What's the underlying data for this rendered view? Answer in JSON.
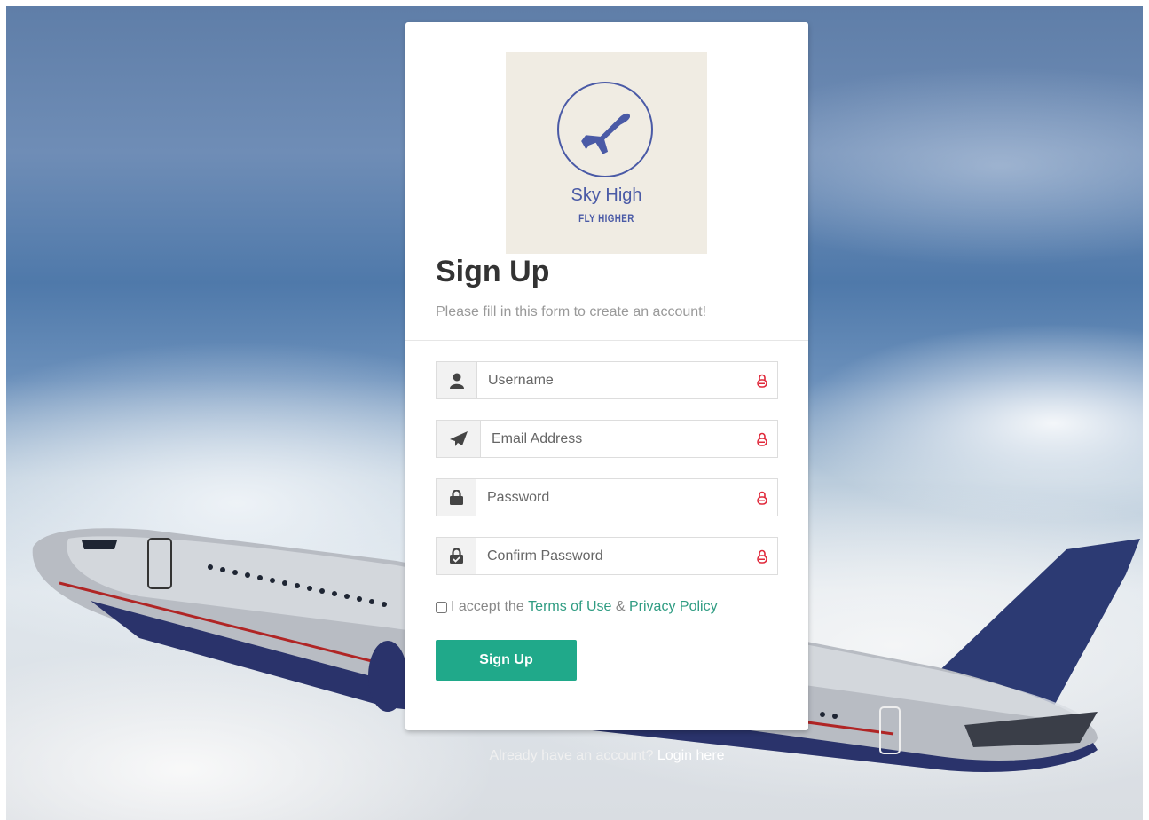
{
  "brand": {
    "name": "Sky High",
    "tagline": "FLY HIGHER",
    "color": "#4a5aa6",
    "background": "#f0ece3",
    "icon": "airplane-icon"
  },
  "form": {
    "title": "Sign Up",
    "subtitle": "Please fill in this form to create an account!",
    "fields": [
      {
        "name": "username",
        "placeholder": "Username",
        "icon": "user-icon",
        "value": ""
      },
      {
        "name": "email",
        "placeholder": "Email Address",
        "icon": "paper-plane-icon",
        "value": ""
      },
      {
        "name": "password",
        "placeholder": "Password",
        "icon": "lock-icon",
        "value": ""
      },
      {
        "name": "confirm_password",
        "placeholder": "Confirm Password",
        "icon": "lock-check-icon",
        "value": ""
      }
    ],
    "required_icon": "password-manager-lock-icon",
    "terms": {
      "prefix": "I accept the",
      "terms_link": "Terms of Use",
      "joiner": "&",
      "privacy_link": "Privacy Policy",
      "checked": false
    },
    "submit_label": "Sign Up",
    "accent_color": "#20a98a"
  },
  "footer": {
    "prompt": "Already have an account?",
    "login_link": "Login here"
  }
}
